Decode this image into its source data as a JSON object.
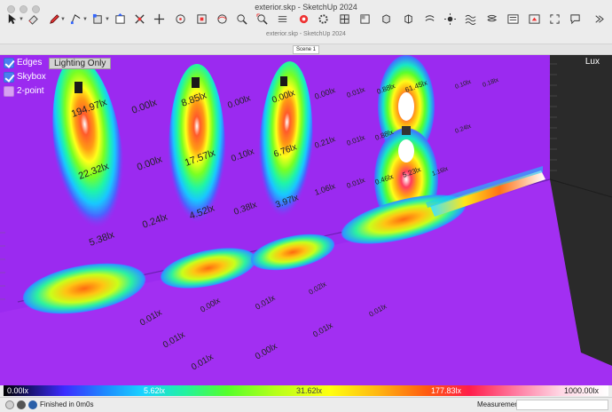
{
  "window": {
    "title": "exterior.skp - SketchUp 2024",
    "subtitle": "exterior.skp - SketchUp 2024"
  },
  "toolbar": {
    "tools": [
      "select-icon",
      "eraser-icon",
      "pencil-icon",
      "rectangle-icon",
      "push-pull-icon",
      "offset-icon",
      "move-icon",
      "rotate-icon",
      "scale-icon",
      "orbit-icon",
      "pan-icon",
      "zoom-icon",
      "zoom-extents-icon",
      "section-icon",
      "texture-icon",
      "settings-icon",
      "layers-icon"
    ]
  },
  "scene_tab": {
    "label": "Scene 1"
  },
  "overlay": {
    "toggles": [
      {
        "label": "Edges",
        "checked": true
      },
      {
        "label": "Skybox",
        "checked": true
      },
      {
        "label": "2-point",
        "checked": false
      }
    ],
    "lighting_button": "Lighting Only",
    "unit_label": "Lux"
  },
  "lux_labels": {
    "wall": [
      "194.97lx",
      "22.32lx",
      "5.38lx",
      "0.00lx",
      "0.00lx",
      "0.24lx",
      "8.85lx",
      "17.57lx",
      "4.52lx",
      "0.00lx",
      "0.10lx",
      "0.38lx",
      "0.00lx",
      "6.76lx",
      "3.97lx",
      "0.00lx",
      "0.21lx",
      "1.06lx",
      "0.01lx",
      "0.01lx",
      "0.01lx",
      "0.88lx",
      "0.88lx",
      "0.46lx",
      "61.45lx",
      "5.23lx",
      "1.16lx",
      "0.24lx",
      "0.10lx",
      "0.18lx"
    ],
    "floor": [
      "0.01lx",
      "0.01lx",
      "0.01lx",
      "0.00lx",
      "0.00lx",
      "0.01lx",
      "0.01lx",
      "0.01lx",
      "0.02lx"
    ]
  },
  "colorbar": {
    "labels": [
      "0.00lx",
      "5.62lx",
      "31.62lx",
      "177.83lx",
      "1000.00lx"
    ]
  },
  "statusbar": {
    "status": "Finished in 0m0s",
    "measurements_label": "Measurements",
    "measurements_value": ""
  },
  "colors": {
    "background": "#9b2af0",
    "wall_dark": "#2a2a2a",
    "accent": "#4a7ff0"
  }
}
